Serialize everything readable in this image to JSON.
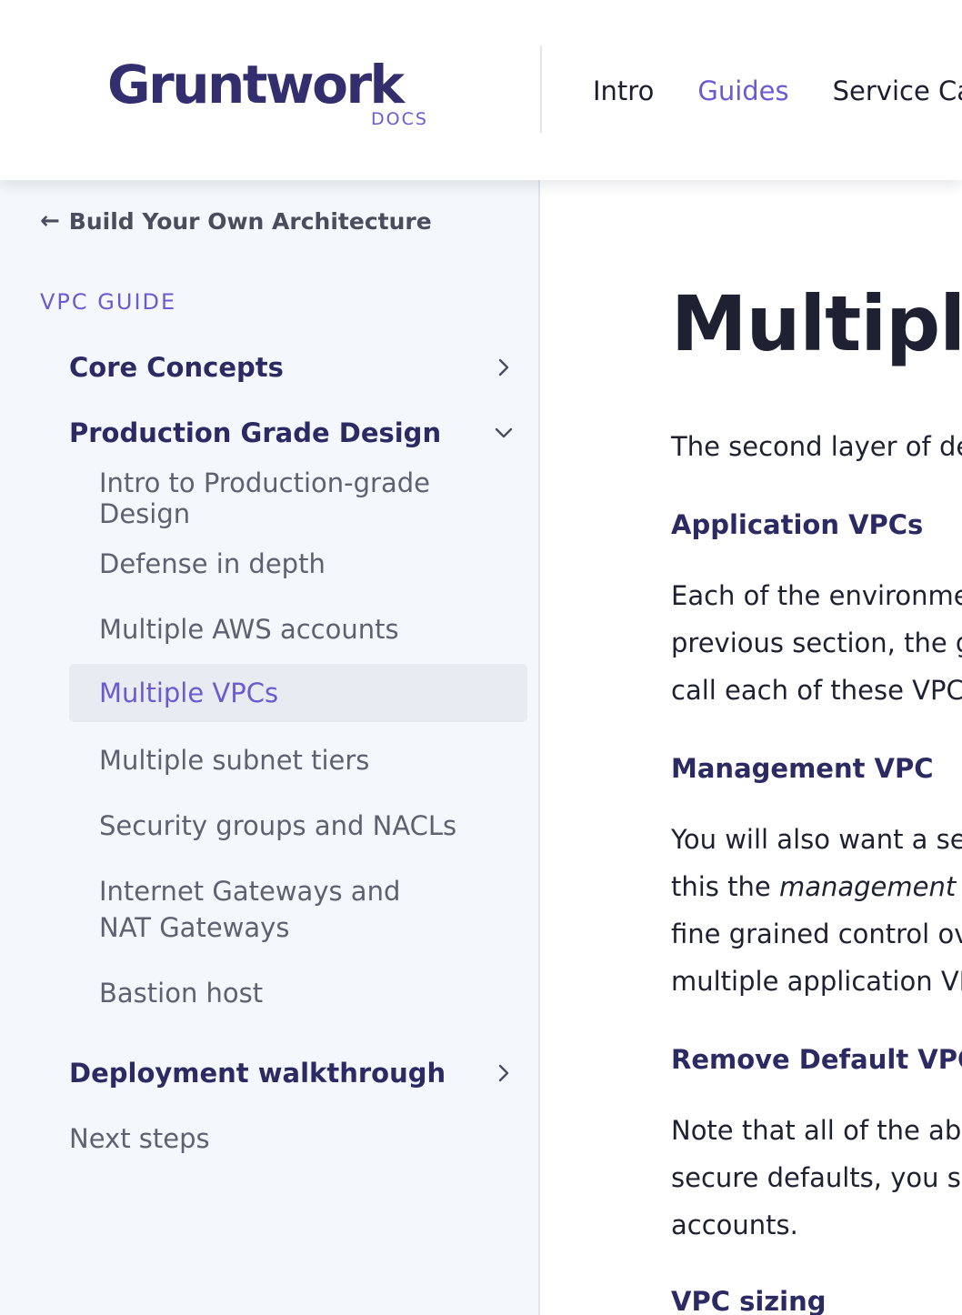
{
  "header": {
    "logo_text": "Gruntwork",
    "logo_sub": "DOCS",
    "nav": [
      {
        "label": "Intro",
        "active": false
      },
      {
        "label": "Guides",
        "active": true
      },
      {
        "label": "Service Cata",
        "active": false
      }
    ]
  },
  "sidebar": {
    "back_label": "Build Your Own Architecture",
    "section_title": "VPC GUIDE",
    "categories": [
      {
        "label": "Core Concepts",
        "icon": "chevron-right-icon"
      },
      {
        "label": "Production Grade Design",
        "icon": "chevron-down-icon"
      },
      {
        "label": "Deployment walkthrough",
        "icon": "chevron-right-icon"
      }
    ],
    "sub_items": [
      "Intro to Production-grade Design",
      "Defense in depth",
      "Multiple AWS accounts",
      "Multiple VPCs",
      "Multiple subnet tiers",
      "Security groups and NACLs",
      "Internet Gateways and NAT Gateways",
      "Bastion host"
    ],
    "active_item": "Multiple VPCs",
    "next_steps": "Next steps"
  },
  "main": {
    "title": "Multiple",
    "intro": "The second layer of defe",
    "sections": [
      {
        "heading": "Application VPCs",
        "lines": [
          "Each of the environment",
          "previous section, the gol",
          "call each of these VPCs y"
        ]
      },
      {
        "heading": "Management VPC",
        "lines": [
          "You will also want a sepa",
          "this the ",
          "management VP",
          "fine grained control over",
          "multiple application VPC"
        ]
      },
      {
        "heading": "Remove Default VPCs",
        "lines": [
          "Note that all of the abov",
          "secure defaults, you sho",
          "accounts."
        ]
      },
      {
        "heading": "VPC sizing",
        "lines": []
      }
    ]
  },
  "colors": {
    "accent": "#6b5bd0",
    "brand_dark": "#332f6e",
    "sidebar_bg": "#f4f7fb",
    "active_bg": "#e7ecf2"
  }
}
